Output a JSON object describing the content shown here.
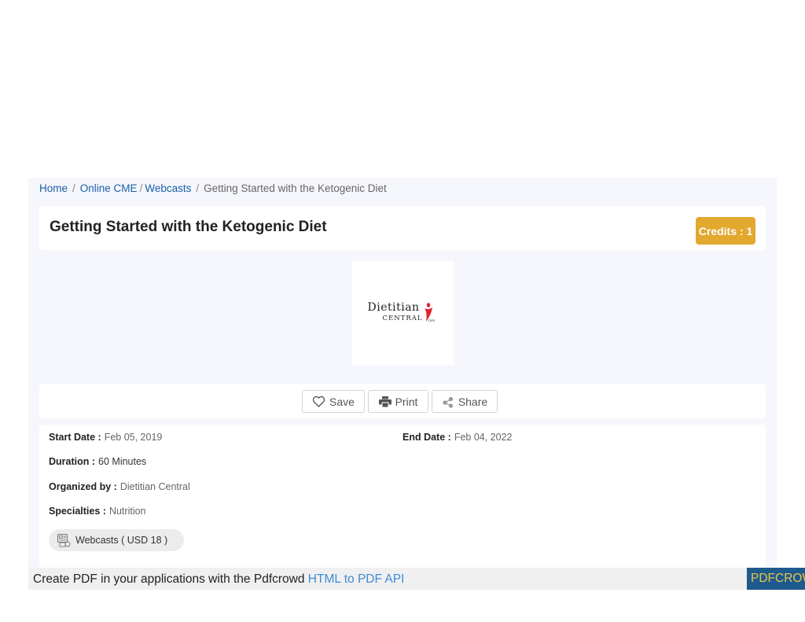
{
  "breadcrumb": {
    "home": "Home",
    "online_cme": "Online CME",
    "webcasts": "Webcasts",
    "current": "Getting Started with the Ketogenic Diet"
  },
  "event": {
    "title": "Getting Started with the Ketogenic Diet",
    "credits": "Credits : 1"
  },
  "logo": {
    "main_text": "Dietitian",
    "sub_text": "CENTRAL",
    "suffix": ".com",
    "accent_color": "#e0232e"
  },
  "actions": {
    "save_label": "Save",
    "print_label": "Print",
    "share_label": "Share"
  },
  "details": {
    "start_date_label": "Start Date :",
    "start_date_value": "Feb 05, 2019",
    "end_date_label": "End Date :",
    "end_date_value": "Feb 04, 2022",
    "duration_label": "Duration :",
    "duration_value": "60 Minutes",
    "organized_label": "Organized by :",
    "organized_value": "Dietitian Central",
    "specialties_label": "Specialties :",
    "specialties_value": "Nutrition",
    "pill_label": "Webcasts ( USD 18 )"
  },
  "pdf_banner": {
    "text": "Create PDF in your applications with the Pdfcrowd",
    "link": "HTML to PDF API",
    "badge": "PDFCROWD"
  },
  "colors": {
    "link": "#1a5ea8",
    "badge": "#e3a82e",
    "page_bg": "#f6f7fc",
    "pdf_badge_bg": "#1f5a8e"
  }
}
